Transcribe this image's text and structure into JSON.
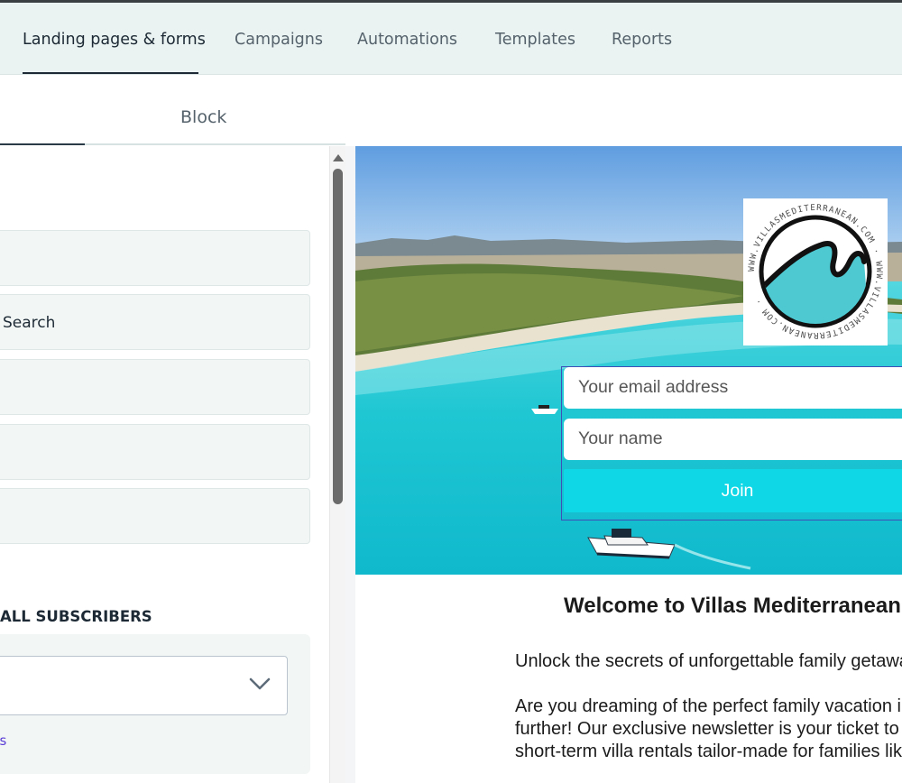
{
  "topnav": {
    "tabs": [
      {
        "label": "Landing pages & forms",
        "active": true
      },
      {
        "label": "Campaigns",
        "active": false
      },
      {
        "label": "Automations",
        "active": false
      },
      {
        "label": "Templates",
        "active": false
      },
      {
        "label": "Reports",
        "active": false
      }
    ]
  },
  "subtabs": {
    "block_label": "Block"
  },
  "left_panel": {
    "fields": [
      "",
      "Search",
      "",
      "",
      ""
    ],
    "section_title": "ALL SUBSCRIBERS",
    "group_select_value": "",
    "link_text": "gs"
  },
  "preview": {
    "email_placeholder": "Your email address",
    "name_placeholder": "Your name",
    "join_label": "Join",
    "welcome_title": "Welcome to Villas Mediterranean",
    "para1": "Unlock the secrets of unforgettable family getaways",
    "para2_line1": "Are you dreaming of the perfect family vacation in",
    "para2_line2": "further! Our exclusive newsletter is your ticket to",
    "para2_line3": "short-term villa rentals tailor-made for families like",
    "logo_ring_text": "WWW.VILLASMEDITERRANEAN.COM"
  },
  "colors": {
    "nav_bg": "#eaf3f2",
    "join_button": "#10d7e5",
    "sea": "#1fc7d3",
    "logo_wave": "#4ec9d1"
  }
}
